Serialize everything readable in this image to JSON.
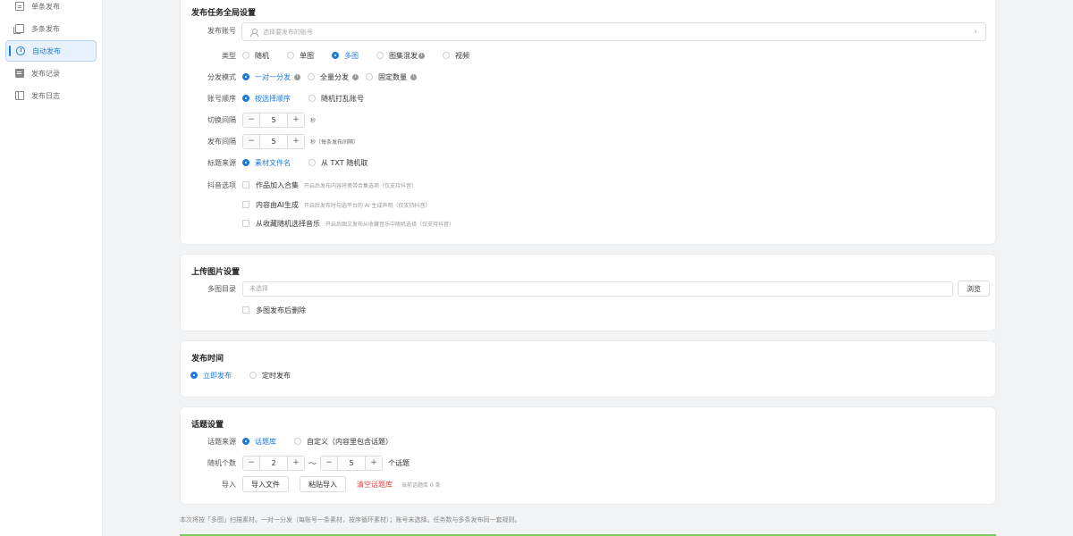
{
  "sidebar": {
    "items": [
      {
        "label": "单条发布",
        "icon": "doc-icon"
      },
      {
        "label": "多条发布",
        "icon": "multi-doc-icon"
      },
      {
        "label": "自动发布",
        "icon": "clock-icon",
        "active": true
      },
      {
        "label": "发布记录",
        "icon": "list-icon"
      },
      {
        "label": "发布日志",
        "icon": "book-icon"
      }
    ]
  },
  "global": {
    "title": "发布任务全局设置",
    "account_label": "发布账号",
    "account_placeholder": "选择要发布的账号",
    "type_label": "类型",
    "type_options": [
      "随机",
      "单图",
      "多图",
      "图集混发",
      "视频"
    ],
    "type_selected": "多图",
    "mode_label": "分发模式",
    "mode_options": [
      "一对一分发",
      "全量分发",
      "固定数量"
    ],
    "mode_selected": "一对一分发",
    "order_label": "账号顺序",
    "order_options": [
      "按选择顺序",
      "随机打乱账号"
    ],
    "order_selected": "按选择顺序",
    "switch_label": "切换间隔",
    "switch_value": "5",
    "switch_unit": "秒",
    "interval_label": "发布间隔",
    "interval_value": "5",
    "interval_unit": "秒（每条发布间隔）",
    "title_source_label": "标题来源",
    "title_source_options": [
      "素材文件名",
      "从 TXT 随机取"
    ],
    "title_source_selected": "素材文件名",
    "douyin_label": "抖音选项",
    "douyin_options": [
      {
        "label": "作品加入合集",
        "hint": "开启后发布内容将携带合集选项（仅支持抖音）"
      },
      {
        "label": "内容由AI生成",
        "hint": "开启后发布时勾选平台的 AI 生成声明（仅支持抖音）"
      },
      {
        "label": "从收藏随机选择音乐",
        "hint": "开启后图文发布从收藏音乐中随机选择（仅支持抖音）"
      }
    ]
  },
  "upload": {
    "title": "上传图片设置",
    "dir_label": "多图目录",
    "dir_placeholder": "未选择",
    "browse_label": "浏览",
    "delete_after_label": "多图发布后删除"
  },
  "publish_time": {
    "title": "发布时间",
    "options": [
      "立即发布",
      "定时发布"
    ],
    "selected": "立即发布"
  },
  "topic": {
    "title": "话题设置",
    "source_label": "话题来源",
    "source_options": [
      "话题库",
      "自定义（内容里包含话题）"
    ],
    "source_selected": "话题库",
    "count_label": "随机个数",
    "count_min": "2",
    "count_sep": "～",
    "count_max": "5",
    "count_unit": "个话题",
    "import_label": "导入",
    "import_file_label": "导入文件",
    "paste_import_label": "粘贴导入",
    "clear_label": "清空话题库",
    "current_count": "当前话题库 0 条"
  },
  "footnote": "本次将按「多图」扫描素材。一对一分发（每账号一条素材，按序循环素材）；账号未选择。任务数与多条发布同一套规则。",
  "colors": {
    "accent": "#1f7bdd",
    "danger": "#e64545",
    "success": "#7ccc5b"
  }
}
